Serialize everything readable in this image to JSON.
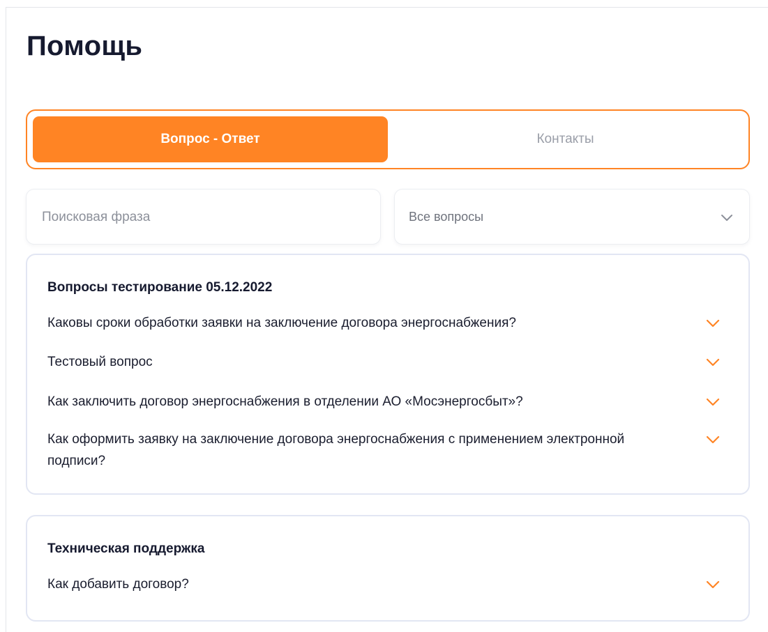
{
  "page": {
    "title": "Помощь"
  },
  "tabs": [
    {
      "label": "Вопрос - Ответ",
      "active": true
    },
    {
      "label": "Контакты",
      "active": false
    }
  ],
  "search": {
    "placeholder": "Поисковая фраза",
    "value": ""
  },
  "filter": {
    "selected": "Все вопросы",
    "icon": "chevron-down-icon"
  },
  "sections": [
    {
      "title": "Вопросы тестирование 05.12.2022",
      "questions": [
        "Каковы сроки обработки заявки на заключение договора энергоснабжения?",
        "Тестовый вопрос",
        "Как заключить договор энергоснабжения в отделении АО «Мосэнергосбыт»?",
        "Как оформить заявку на заключение договора энергоснабжения с применением электронной подписи?"
      ]
    },
    {
      "title": "Техническая поддержка",
      "questions": [
        "Как добавить договор?"
      ]
    }
  ],
  "colors": {
    "accent": "#ff8424",
    "title_text": "#161a2f",
    "muted_text": "#9a9ea8",
    "card_border": "#e2e6f3"
  }
}
